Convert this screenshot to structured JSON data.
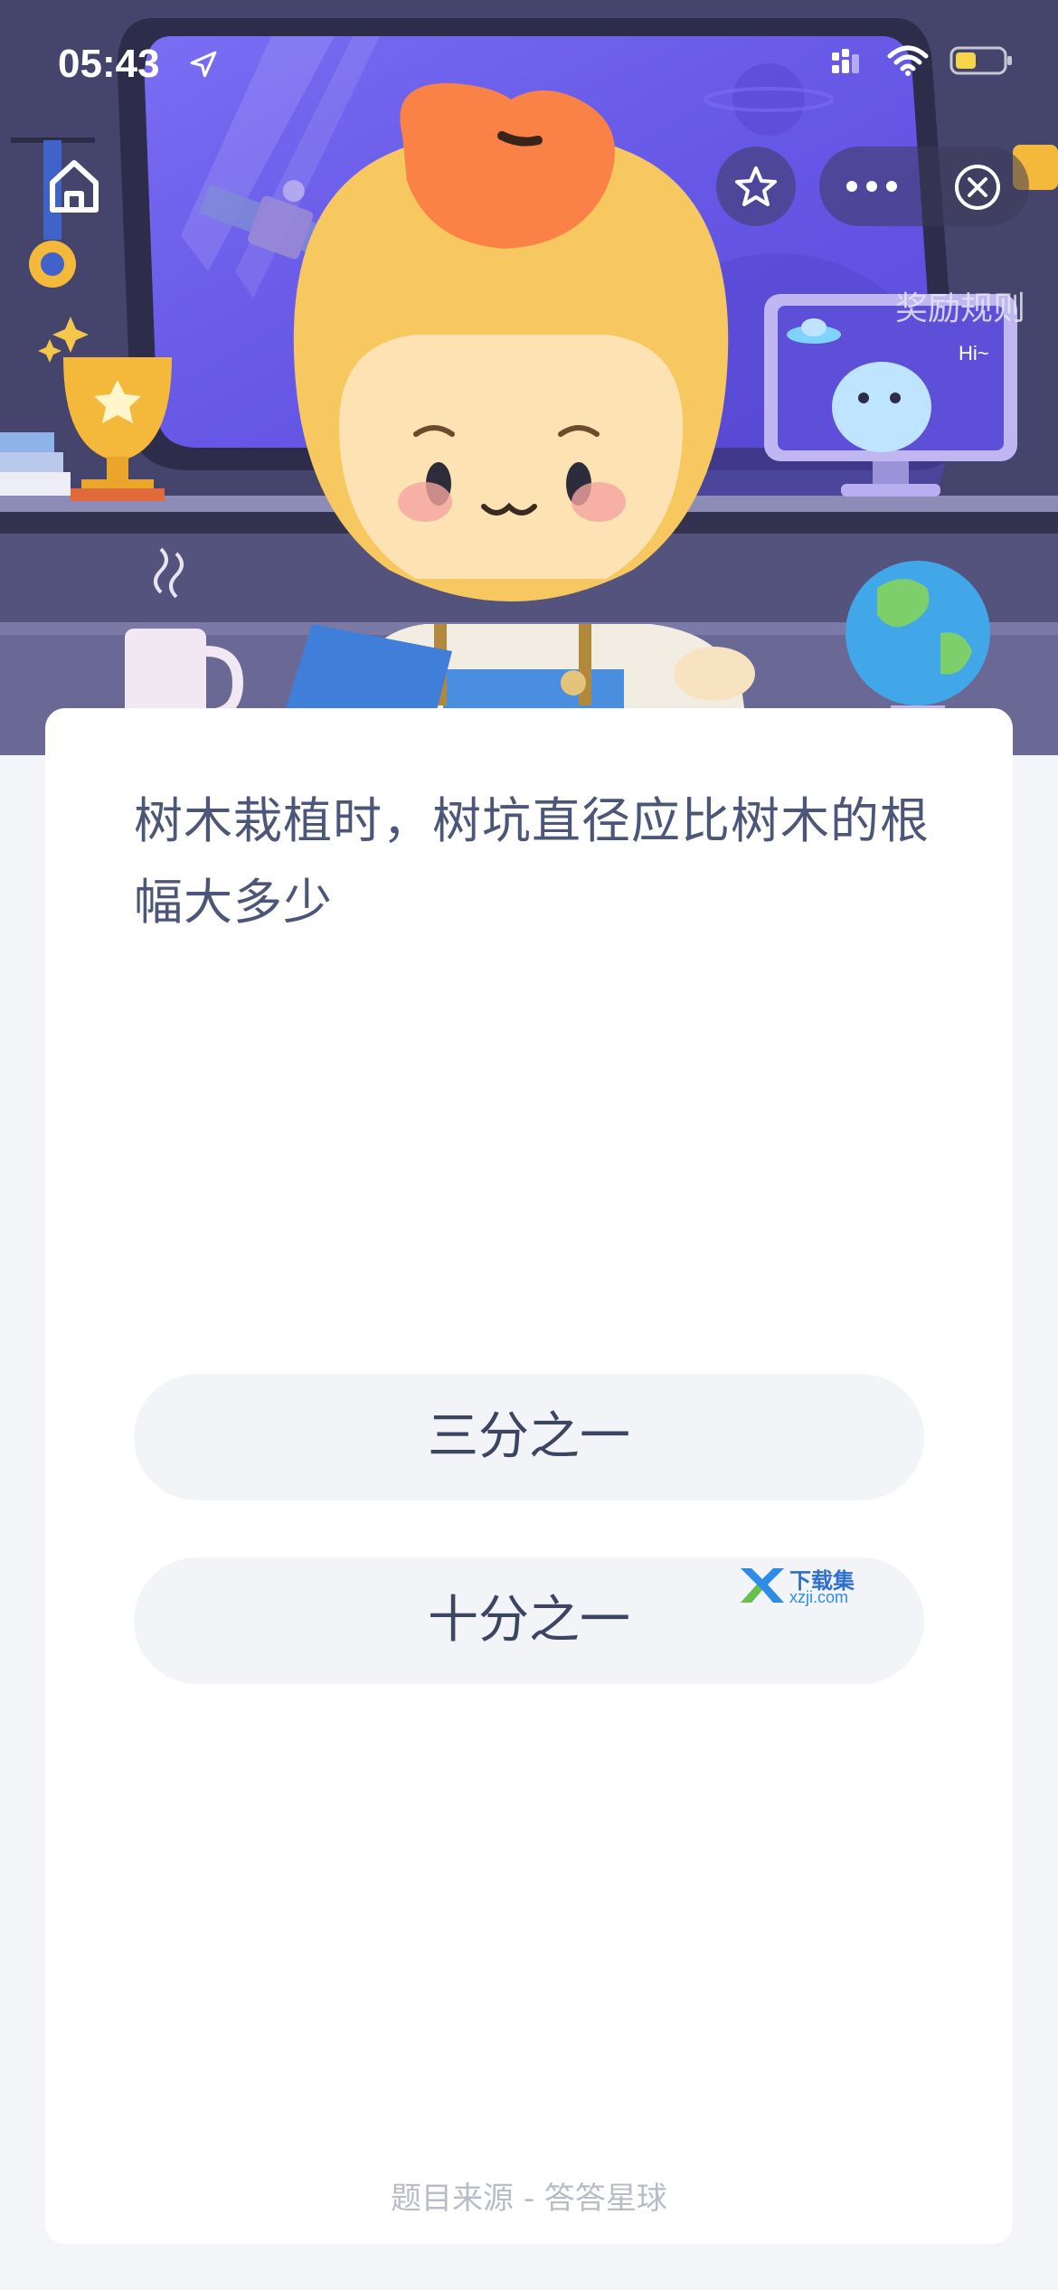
{
  "status_bar": {
    "time": "05:43",
    "icons": [
      "location-arrow-icon",
      "cellular-signal-icon",
      "wifi-icon",
      "battery-icon"
    ]
  },
  "nav": {
    "home_icon": "home-icon",
    "favorite_icon": "star-icon",
    "more_icon": "more-icon",
    "close_icon": "close-circle-icon",
    "reward_rules": "奖励规则"
  },
  "quiz": {
    "question": "树木栽植时，树坑直径应比树木的根幅大多少",
    "options": [
      "三分之一",
      "十分之一"
    ],
    "source": "题目来源 - 答答星球"
  },
  "watermark": {
    "name": "下载集",
    "domain": "xzji.com"
  },
  "colors": {
    "hero_bg": "#3d3c63",
    "window_bg": "#5a4de0",
    "character_head": "#f6c85f",
    "character_leaf": "#fb8247",
    "card_bg": "#ffffff",
    "page_bg": "#f4f5f8",
    "option_bg": "#f2f4f7",
    "question_text": "#4c5678"
  }
}
